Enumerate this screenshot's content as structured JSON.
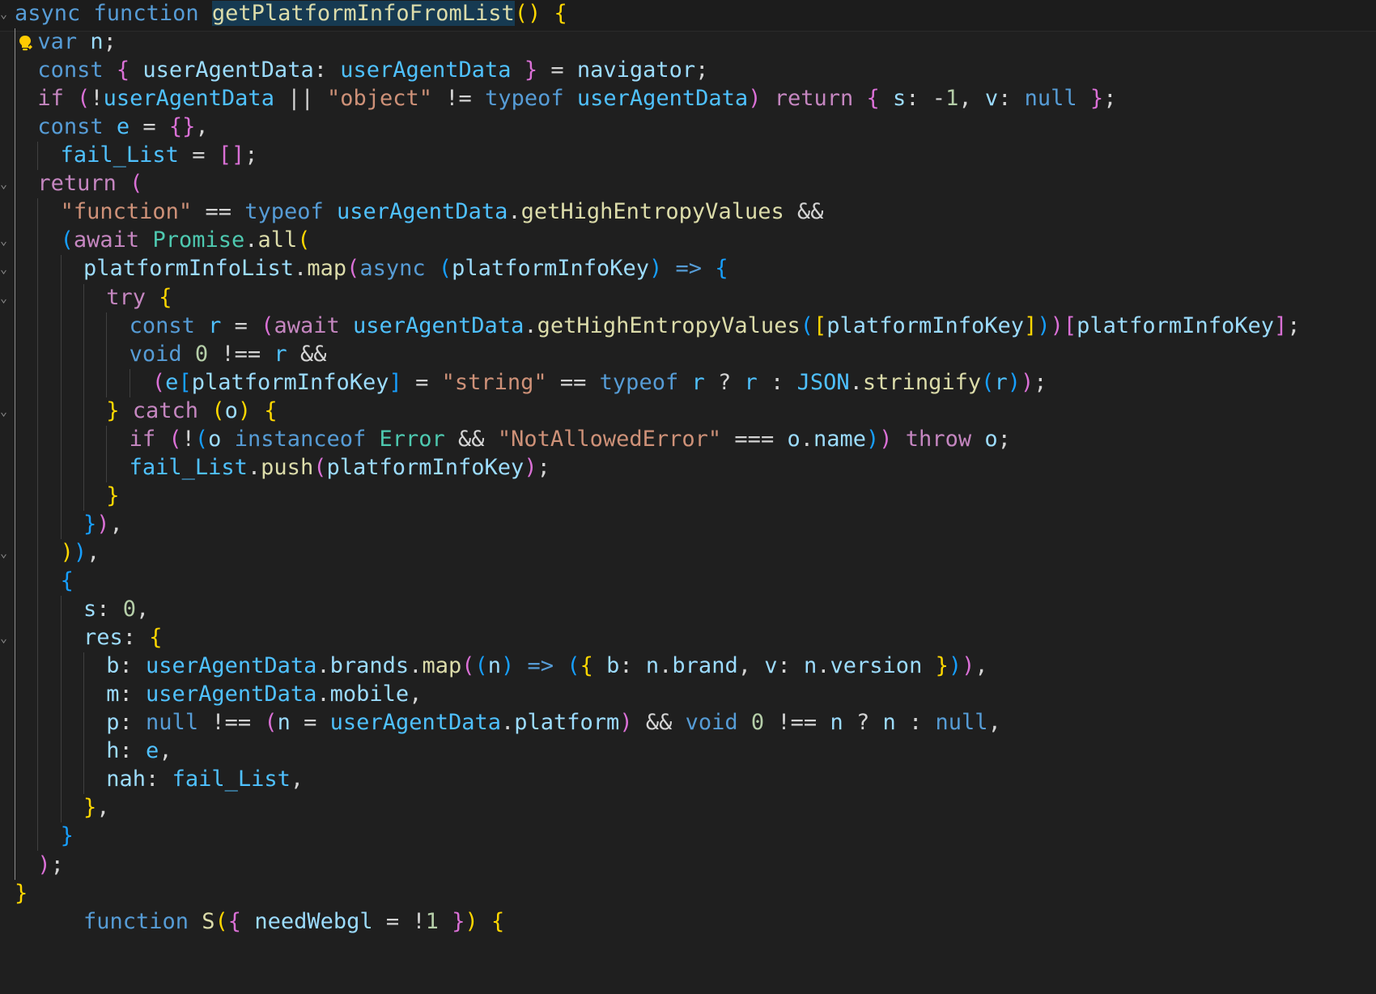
{
  "editor": {
    "language": "javascript",
    "highlight_color": "#163a52",
    "background_color": "#1f1f1f",
    "lines": [
      [
        {
          "t": "async ",
          "c": "kw"
        },
        {
          "t": "function ",
          "c": "kw"
        },
        {
          "t": "getPlatformInfoFromList",
          "c": "fn",
          "sel": true
        },
        {
          "t": "()",
          "c": "b1"
        },
        {
          "t": " ",
          "c": "op"
        },
        {
          "t": "{",
          "c": "b1"
        }
      ],
      [
        {
          "t": "var ",
          "c": "kw"
        },
        {
          "t": "n",
          "c": "var"
        },
        {
          "t": ";",
          "c": "op"
        }
      ],
      [
        {
          "t": "const ",
          "c": "kw"
        },
        {
          "t": "{",
          "c": "b2"
        },
        {
          "t": " userAgentData",
          "c": "var"
        },
        {
          "t": ": ",
          "c": "op"
        },
        {
          "t": "userAgentData",
          "c": "cst"
        },
        {
          "t": " ",
          "c": "op"
        },
        {
          "t": "}",
          "c": "b2"
        },
        {
          "t": " = ",
          "c": "op"
        },
        {
          "t": "navigator",
          "c": "var"
        },
        {
          "t": ";",
          "c": "op"
        }
      ],
      [
        {
          "t": "if ",
          "c": "ctrl"
        },
        {
          "t": "(",
          "c": "b2"
        },
        {
          "t": "!",
          "c": "op"
        },
        {
          "t": "userAgentData",
          "c": "cst"
        },
        {
          "t": " || ",
          "c": "op"
        },
        {
          "t": "\"object\"",
          "c": "str"
        },
        {
          "t": " != ",
          "c": "op"
        },
        {
          "t": "typeof ",
          "c": "kw"
        },
        {
          "t": "userAgentData",
          "c": "cst"
        },
        {
          "t": ")",
          "c": "b2"
        },
        {
          "t": " return ",
          "c": "ctrl"
        },
        {
          "t": "{",
          "c": "b2"
        },
        {
          "t": " s",
          "c": "var"
        },
        {
          "t": ": ",
          "c": "op"
        },
        {
          "t": "-",
          "c": "op"
        },
        {
          "t": "1",
          "c": "num"
        },
        {
          "t": ", ",
          "c": "op"
        },
        {
          "t": "v",
          "c": "var"
        },
        {
          "t": ": ",
          "c": "op"
        },
        {
          "t": "null",
          "c": "kw"
        },
        {
          "t": " ",
          "c": "op"
        },
        {
          "t": "}",
          "c": "b2"
        },
        {
          "t": ";",
          "c": "op"
        }
      ],
      [
        {
          "t": "const ",
          "c": "kw"
        },
        {
          "t": "e",
          "c": "cst"
        },
        {
          "t": " = ",
          "c": "op"
        },
        {
          "t": "{}",
          "c": "b2"
        },
        {
          "t": ",",
          "c": "op"
        }
      ],
      [
        {
          "t": "fail_List",
          "c": "cst"
        },
        {
          "t": " = ",
          "c": "op"
        },
        {
          "t": "[]",
          "c": "b2"
        },
        {
          "t": ";",
          "c": "op"
        }
      ],
      [
        {
          "t": "return ",
          "c": "ctrl"
        },
        {
          "t": "(",
          "c": "b2"
        }
      ],
      [
        {
          "t": "\"function\"",
          "c": "str"
        },
        {
          "t": " == ",
          "c": "op"
        },
        {
          "t": "typeof ",
          "c": "kw"
        },
        {
          "t": "userAgentData",
          "c": "cst"
        },
        {
          "t": ".",
          "c": "op"
        },
        {
          "t": "getHighEntropyValues",
          "c": "fn"
        },
        {
          "t": " &&",
          "c": "op"
        }
      ],
      [
        {
          "t": "(",
          "c": "b3"
        },
        {
          "t": "await ",
          "c": "ctrl"
        },
        {
          "t": "Promise",
          "c": "type"
        },
        {
          "t": ".",
          "c": "op"
        },
        {
          "t": "all",
          "c": "fn"
        },
        {
          "t": "(",
          "c": "b1"
        }
      ],
      [
        {
          "t": "platformInfoList",
          "c": "var"
        },
        {
          "t": ".",
          "c": "op"
        },
        {
          "t": "map",
          "c": "fn"
        },
        {
          "t": "(",
          "c": "b2"
        },
        {
          "t": "async ",
          "c": "kw"
        },
        {
          "t": "(",
          "c": "b3"
        },
        {
          "t": "platformInfoKey",
          "c": "var"
        },
        {
          "t": ")",
          "c": "b3"
        },
        {
          "t": " => ",
          "c": "kw"
        },
        {
          "t": "{",
          "c": "b3"
        }
      ],
      [
        {
          "t": "try ",
          "c": "ctrl"
        },
        {
          "t": "{",
          "c": "b1"
        }
      ],
      [
        {
          "t": "const ",
          "c": "kw"
        },
        {
          "t": "r",
          "c": "cst"
        },
        {
          "t": " = ",
          "c": "op"
        },
        {
          "t": "(",
          "c": "b2"
        },
        {
          "t": "await ",
          "c": "ctrl"
        },
        {
          "t": "userAgentData",
          "c": "cst"
        },
        {
          "t": ".",
          "c": "op"
        },
        {
          "t": "getHighEntropyValues",
          "c": "fn"
        },
        {
          "t": "(",
          "c": "b3"
        },
        {
          "t": "[",
          "c": "b1"
        },
        {
          "t": "platformInfoKey",
          "c": "var"
        },
        {
          "t": "]",
          "c": "b1"
        },
        {
          "t": ")",
          "c": "b3"
        },
        {
          "t": ")",
          "c": "b2"
        },
        {
          "t": "[",
          "c": "b2"
        },
        {
          "t": "platformInfoKey",
          "c": "var"
        },
        {
          "t": "]",
          "c": "b2"
        },
        {
          "t": ";",
          "c": "op"
        }
      ],
      [
        {
          "t": "void ",
          "c": "kw"
        },
        {
          "t": "0",
          "c": "num"
        },
        {
          "t": " !== ",
          "c": "op"
        },
        {
          "t": "r",
          "c": "cst"
        },
        {
          "t": " &&",
          "c": "op"
        }
      ],
      [
        {
          "t": "(",
          "c": "b2"
        },
        {
          "t": "e",
          "c": "cst"
        },
        {
          "t": "[",
          "c": "b3"
        },
        {
          "t": "platformInfoKey",
          "c": "var"
        },
        {
          "t": "]",
          "c": "b3"
        },
        {
          "t": " = ",
          "c": "op"
        },
        {
          "t": "\"string\"",
          "c": "str"
        },
        {
          "t": " == ",
          "c": "op"
        },
        {
          "t": "typeof ",
          "c": "kw"
        },
        {
          "t": "r",
          "c": "cst"
        },
        {
          "t": " ? ",
          "c": "op"
        },
        {
          "t": "r",
          "c": "cst"
        },
        {
          "t": " : ",
          "c": "op"
        },
        {
          "t": "JSON",
          "c": "cst"
        },
        {
          "t": ".",
          "c": "op"
        },
        {
          "t": "stringify",
          "c": "fn"
        },
        {
          "t": "(",
          "c": "b3"
        },
        {
          "t": "r",
          "c": "cst"
        },
        {
          "t": ")",
          "c": "b3"
        },
        {
          "t": ")",
          "c": "b2"
        },
        {
          "t": ";",
          "c": "op"
        }
      ],
      [
        {
          "t": "}",
          "c": "b1"
        },
        {
          "t": " catch ",
          "c": "ctrl"
        },
        {
          "t": "(",
          "c": "b1"
        },
        {
          "t": "o",
          "c": "var"
        },
        {
          "t": ")",
          "c": "b1"
        },
        {
          "t": " ",
          "c": "op"
        },
        {
          "t": "{",
          "c": "b1"
        }
      ],
      [
        {
          "t": "if ",
          "c": "ctrl"
        },
        {
          "t": "(",
          "c": "b2"
        },
        {
          "t": "!",
          "c": "op"
        },
        {
          "t": "(",
          "c": "b3"
        },
        {
          "t": "o",
          "c": "var"
        },
        {
          "t": " instanceof ",
          "c": "kw"
        },
        {
          "t": "Error",
          "c": "type"
        },
        {
          "t": " && ",
          "c": "op"
        },
        {
          "t": "\"NotAllowedError\"",
          "c": "str"
        },
        {
          "t": " === ",
          "c": "op"
        },
        {
          "t": "o",
          "c": "var"
        },
        {
          "t": ".",
          "c": "op"
        },
        {
          "t": "name",
          "c": "var"
        },
        {
          "t": ")",
          "c": "b3"
        },
        {
          "t": ")",
          "c": "b2"
        },
        {
          "t": " throw ",
          "c": "ctrl"
        },
        {
          "t": "o",
          "c": "var"
        },
        {
          "t": ";",
          "c": "op"
        }
      ],
      [
        {
          "t": "fail_List",
          "c": "cst"
        },
        {
          "t": ".",
          "c": "op"
        },
        {
          "t": "push",
          "c": "fn"
        },
        {
          "t": "(",
          "c": "b2"
        },
        {
          "t": "platformInfoKey",
          "c": "var"
        },
        {
          "t": ")",
          "c": "b2"
        },
        {
          "t": ";",
          "c": "op"
        }
      ],
      [
        {
          "t": "}",
          "c": "b1"
        }
      ],
      [
        {
          "t": "}",
          "c": "b3"
        },
        {
          "t": ")",
          "c": "b2"
        },
        {
          "t": ",",
          "c": "op"
        }
      ],
      [
        {
          "t": ")",
          "c": "b1"
        },
        {
          "t": ")",
          "c": "b3"
        },
        {
          "t": ",",
          "c": "op"
        }
      ],
      [
        {
          "t": "{",
          "c": "b3"
        }
      ],
      [
        {
          "t": "s",
          "c": "var"
        },
        {
          "t": ": ",
          "c": "op"
        },
        {
          "t": "0",
          "c": "num"
        },
        {
          "t": ",",
          "c": "op"
        }
      ],
      [
        {
          "t": "res",
          "c": "var"
        },
        {
          "t": ": ",
          "c": "op"
        },
        {
          "t": "{",
          "c": "b1"
        }
      ],
      [
        {
          "t": "b",
          "c": "var"
        },
        {
          "t": ": ",
          "c": "op"
        },
        {
          "t": "userAgentData",
          "c": "cst"
        },
        {
          "t": ".",
          "c": "op"
        },
        {
          "t": "brands",
          "c": "var"
        },
        {
          "t": ".",
          "c": "op"
        },
        {
          "t": "map",
          "c": "fn"
        },
        {
          "t": "(",
          "c": "b2"
        },
        {
          "t": "(",
          "c": "b3"
        },
        {
          "t": "n",
          "c": "var"
        },
        {
          "t": ")",
          "c": "b3"
        },
        {
          "t": " => ",
          "c": "kw"
        },
        {
          "t": "(",
          "c": "b3"
        },
        {
          "t": "{",
          "c": "b1"
        },
        {
          "t": " b",
          "c": "var"
        },
        {
          "t": ": ",
          "c": "op"
        },
        {
          "t": "n",
          "c": "var"
        },
        {
          "t": ".",
          "c": "op"
        },
        {
          "t": "brand",
          "c": "var"
        },
        {
          "t": ", ",
          "c": "op"
        },
        {
          "t": "v",
          "c": "var"
        },
        {
          "t": ": ",
          "c": "op"
        },
        {
          "t": "n",
          "c": "var"
        },
        {
          "t": ".",
          "c": "op"
        },
        {
          "t": "version",
          "c": "var"
        },
        {
          "t": " ",
          "c": "op"
        },
        {
          "t": "}",
          "c": "b1"
        },
        {
          "t": ")",
          "c": "b3"
        },
        {
          "t": ")",
          "c": "b2"
        },
        {
          "t": ",",
          "c": "op"
        }
      ],
      [
        {
          "t": "m",
          "c": "var"
        },
        {
          "t": ": ",
          "c": "op"
        },
        {
          "t": "userAgentData",
          "c": "cst"
        },
        {
          "t": ".",
          "c": "op"
        },
        {
          "t": "mobile",
          "c": "var"
        },
        {
          "t": ",",
          "c": "op"
        }
      ],
      [
        {
          "t": "p",
          "c": "var"
        },
        {
          "t": ": ",
          "c": "op"
        },
        {
          "t": "null",
          "c": "kw"
        },
        {
          "t": " !== ",
          "c": "op"
        },
        {
          "t": "(",
          "c": "b2"
        },
        {
          "t": "n",
          "c": "var"
        },
        {
          "t": " = ",
          "c": "op"
        },
        {
          "t": "userAgentData",
          "c": "cst"
        },
        {
          "t": ".",
          "c": "op"
        },
        {
          "t": "platform",
          "c": "var"
        },
        {
          "t": ")",
          "c": "b2"
        },
        {
          "t": " && ",
          "c": "op"
        },
        {
          "t": "void ",
          "c": "kw"
        },
        {
          "t": "0",
          "c": "num"
        },
        {
          "t": " !== ",
          "c": "op"
        },
        {
          "t": "n",
          "c": "var"
        },
        {
          "t": " ? ",
          "c": "op"
        },
        {
          "t": "n",
          "c": "var"
        },
        {
          "t": " : ",
          "c": "op"
        },
        {
          "t": "null",
          "c": "kw"
        },
        {
          "t": ",",
          "c": "op"
        }
      ],
      [
        {
          "t": "h",
          "c": "var"
        },
        {
          "t": ": ",
          "c": "op"
        },
        {
          "t": "e",
          "c": "cst"
        },
        {
          "t": ",",
          "c": "op"
        }
      ],
      [
        {
          "t": "nah",
          "c": "var"
        },
        {
          "t": ": ",
          "c": "op"
        },
        {
          "t": "fail_List",
          "c": "cst"
        },
        {
          "t": ",",
          "c": "op"
        }
      ],
      [
        {
          "t": "}",
          "c": "b1"
        },
        {
          "t": ",",
          "c": "op"
        }
      ],
      [
        {
          "t": "}",
          "c": "b3"
        }
      ],
      [
        {
          "t": ")",
          "c": "b2"
        },
        {
          "t": ";",
          "c": "op"
        }
      ],
      [
        {
          "t": "}",
          "c": "b1"
        }
      ],
      [
        {
          "t": "function ",
          "c": "kw"
        },
        {
          "t": "S",
          "c": "fn"
        },
        {
          "t": "(",
          "c": "b1"
        },
        {
          "t": "{",
          "c": "b2"
        },
        {
          "t": " needWebgl",
          "c": "var"
        },
        {
          "t": " = ",
          "c": "op"
        },
        {
          "t": "!",
          "c": "op"
        },
        {
          "t": "1",
          "c": "num"
        },
        {
          "t": " ",
          "c": "op"
        },
        {
          "t": "}",
          "c": "b2"
        },
        {
          "t": ")",
          "c": "b1"
        },
        {
          "t": " ",
          "c": "op"
        },
        {
          "t": "{",
          "c": "b1"
        }
      ]
    ]
  }
}
